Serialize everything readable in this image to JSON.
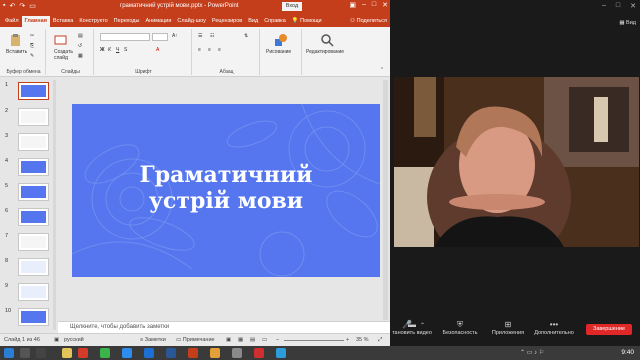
{
  "ppt": {
    "qat_icons": [
      "save-icon",
      "undo-icon",
      "redo-icon",
      "present-icon"
    ],
    "title": "граматичний устрій мови.pptx  -  PowerPoint",
    "signin": "Вход",
    "tabs": [
      "Файл",
      "Главная",
      "Вставка",
      "Конструкто",
      "Переходы",
      "Анимации",
      "Слайд-шоу",
      "Рецензиров",
      "Вид",
      "Справка"
    ],
    "tell_me": "Помощи",
    "share": "Поделиться",
    "ribbon": {
      "paste": "Вставить",
      "clipboard": "Буфер обмена",
      "new_slide": "Создать слайд",
      "slides": "Слайды",
      "font": "Шрифт",
      "paragraph": "Абзац",
      "drawing": "Рисование",
      "editing": "Редактирование"
    },
    "thumb_numbers": [
      "1",
      "2",
      "3",
      "4",
      "5",
      "6",
      "7",
      "8",
      "9",
      "10"
    ],
    "slide": {
      "title_line1": "Граматичний",
      "title_line2": "устрій мови",
      "background": "#5576ee"
    },
    "notes_placeholder": "Щелкните, чтобы добавить заметки",
    "status": {
      "slide_of": "Слайд 1 из 46",
      "language": "русский",
      "notes": "Заметки",
      "comments": "Примечание",
      "zoom": "35 %"
    },
    "accent": "#c43e1c"
  },
  "zoom": {
    "view": "Вид",
    "buttons": [
      {
        "label": "тановить видео",
        "icon": "video-icon"
      },
      {
        "label": "Безопасность",
        "icon": "shield-icon"
      },
      {
        "label": "Приложения",
        "icon": "apps-icon"
      },
      {
        "label": "Дополнительно",
        "icon": "more-icon"
      }
    ],
    "end": "Завершение"
  },
  "taskbar": {
    "time": "9:40"
  }
}
